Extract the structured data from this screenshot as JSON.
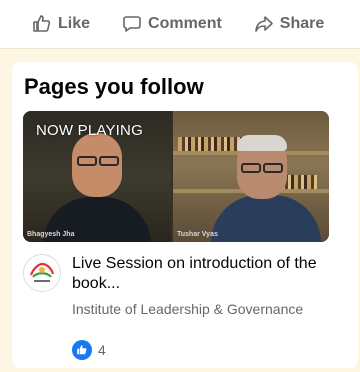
{
  "actions": {
    "like_label": "Like",
    "comment_label": "Comment",
    "share_label": "Share"
  },
  "section": {
    "title": "Pages you follow"
  },
  "video": {
    "status_label": "NOW PLAYING",
    "participant_left": "Bhagyesh Jha",
    "participant_right": "Tushar Vyas"
  },
  "post": {
    "title": "Live Session on introduction of the book...",
    "page_name": "Institute of Leadership & Governance",
    "reaction_count": "4",
    "reaction_icon": "thumbs-up-icon"
  },
  "colors": {
    "background": "#fdf6e3",
    "card": "#ffffff",
    "action_text": "#65676b",
    "title_text": "#050505",
    "accent_blue": "#1877f2"
  }
}
